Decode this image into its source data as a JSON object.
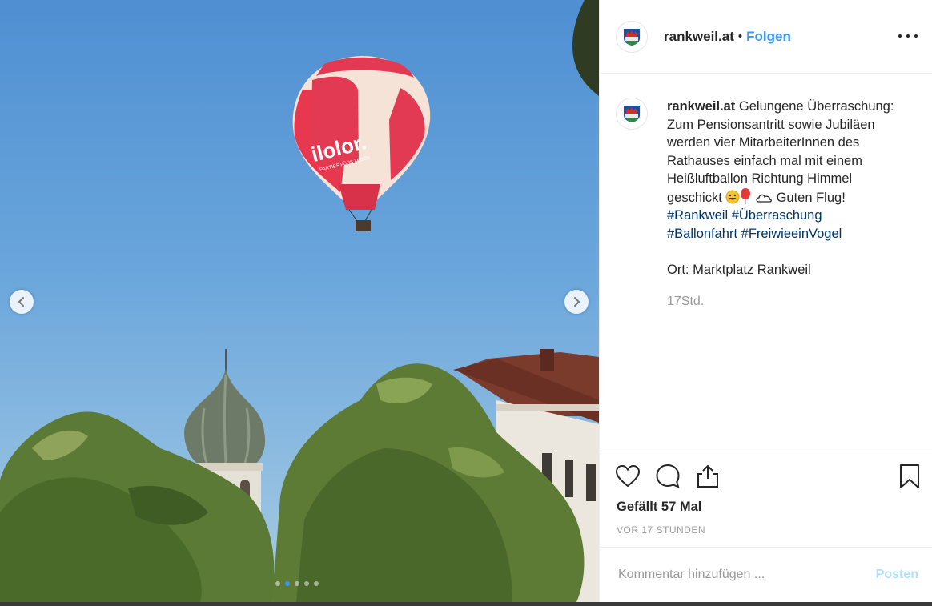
{
  "post": {
    "username": "rankweil.at",
    "separator": "•",
    "follow_label": "Folgen",
    "caption_username": "rankweil.at",
    "caption_text": "Gelungene Überraschung: Zum Pensionsantritt sowie Jubiläen werden vier MitarbeiterInnen des Rathauses einfach mal mit einem Heißluftballon Richtung Himmel geschickt",
    "caption_after_emoji": "Guten Flug!",
    "hashtags": [
      "#Rankweil",
      "#Überraschung",
      "#Ballonfahrt",
      "#FreiwieeinVogel"
    ],
    "location_line": "Ort: Marktplatz Rankweil",
    "relative_time": "17Std.",
    "likes": "Gefällt 57 Mal",
    "timestamp": "VOR 17 STUNDEN",
    "comment_placeholder": "Kommentar hinzufügen ...",
    "post_label": "Posten"
  },
  "media": {
    "balloon_text": "ilolor.",
    "balloon_subtext": "PARTIES FÜRS LEBEN",
    "carousel_count": 5,
    "carousel_active": 1
  },
  "icons": {
    "avatar": "rankweil-crest-icon",
    "more": "more-dots-icon",
    "like": "heart-icon",
    "comment": "speech-bubble-icon",
    "share": "share-icon",
    "save": "bookmark-icon",
    "prev": "chevron-left-icon",
    "next": "chevron-right-icon"
  },
  "colors": {
    "accent": "#3897f0",
    "hashtag": "#003569",
    "muted": "#999999",
    "post_disabled": "#b2dffc"
  }
}
